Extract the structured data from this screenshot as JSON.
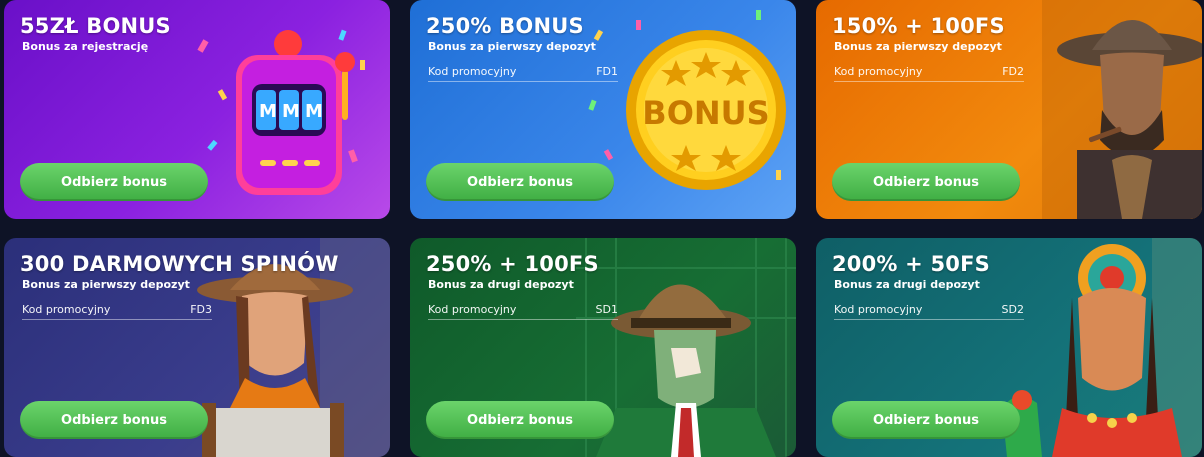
{
  "cards": [
    {
      "title": "55ZŁ BONUS",
      "subtitle": "Bonus za rejestrację",
      "promo_label": "",
      "promo_code": "",
      "button": "Odbierz bonus",
      "art": "slot-machine-icon"
    },
    {
      "title": "250% BONUS",
      "subtitle": "Bonus za pierwszy depozyt",
      "promo_label": "Kod promocyjny",
      "promo_code": "FD1",
      "button": "Odbierz bonus",
      "art": "bonus-coin-icon"
    },
    {
      "title": "150% + 100FS",
      "subtitle": "Bonus za pierwszy depozyt",
      "promo_label": "Kod promocyjny",
      "promo_code": "FD2",
      "button": "Odbierz bonus",
      "art": "cowboy-character-icon"
    },
    {
      "title": "300 DARMOWYCH SPINÓW",
      "subtitle": "Bonus za pierwszy depozyt",
      "promo_label": "Kod promocyjny",
      "promo_code": "FD3",
      "button": "Odbierz bonus",
      "art": "explorer-woman-icon"
    },
    {
      "title": "250% + 100FS",
      "subtitle": "Bonus za drugi depozyt",
      "promo_label": "Kod promocyjny",
      "promo_code": "SD1",
      "button": "Odbierz bonus",
      "art": "detective-character-icon"
    },
    {
      "title": "200% + 50FS",
      "subtitle": "Bonus za drugi depozyt",
      "promo_label": "Kod promocyjny",
      "promo_code": "SD2",
      "button": "Odbierz bonus",
      "art": "aztec-woman-icon"
    }
  ],
  "colors": {
    "page_bg": "#0e1326",
    "button_green": "#4cbf50",
    "card_purple": "#8b21e0",
    "card_blue": "#3a86ea",
    "card_orange": "#f28a0d",
    "card_indigo": "#3a3d8c",
    "card_green": "#176e34",
    "card_teal": "#147279"
  }
}
